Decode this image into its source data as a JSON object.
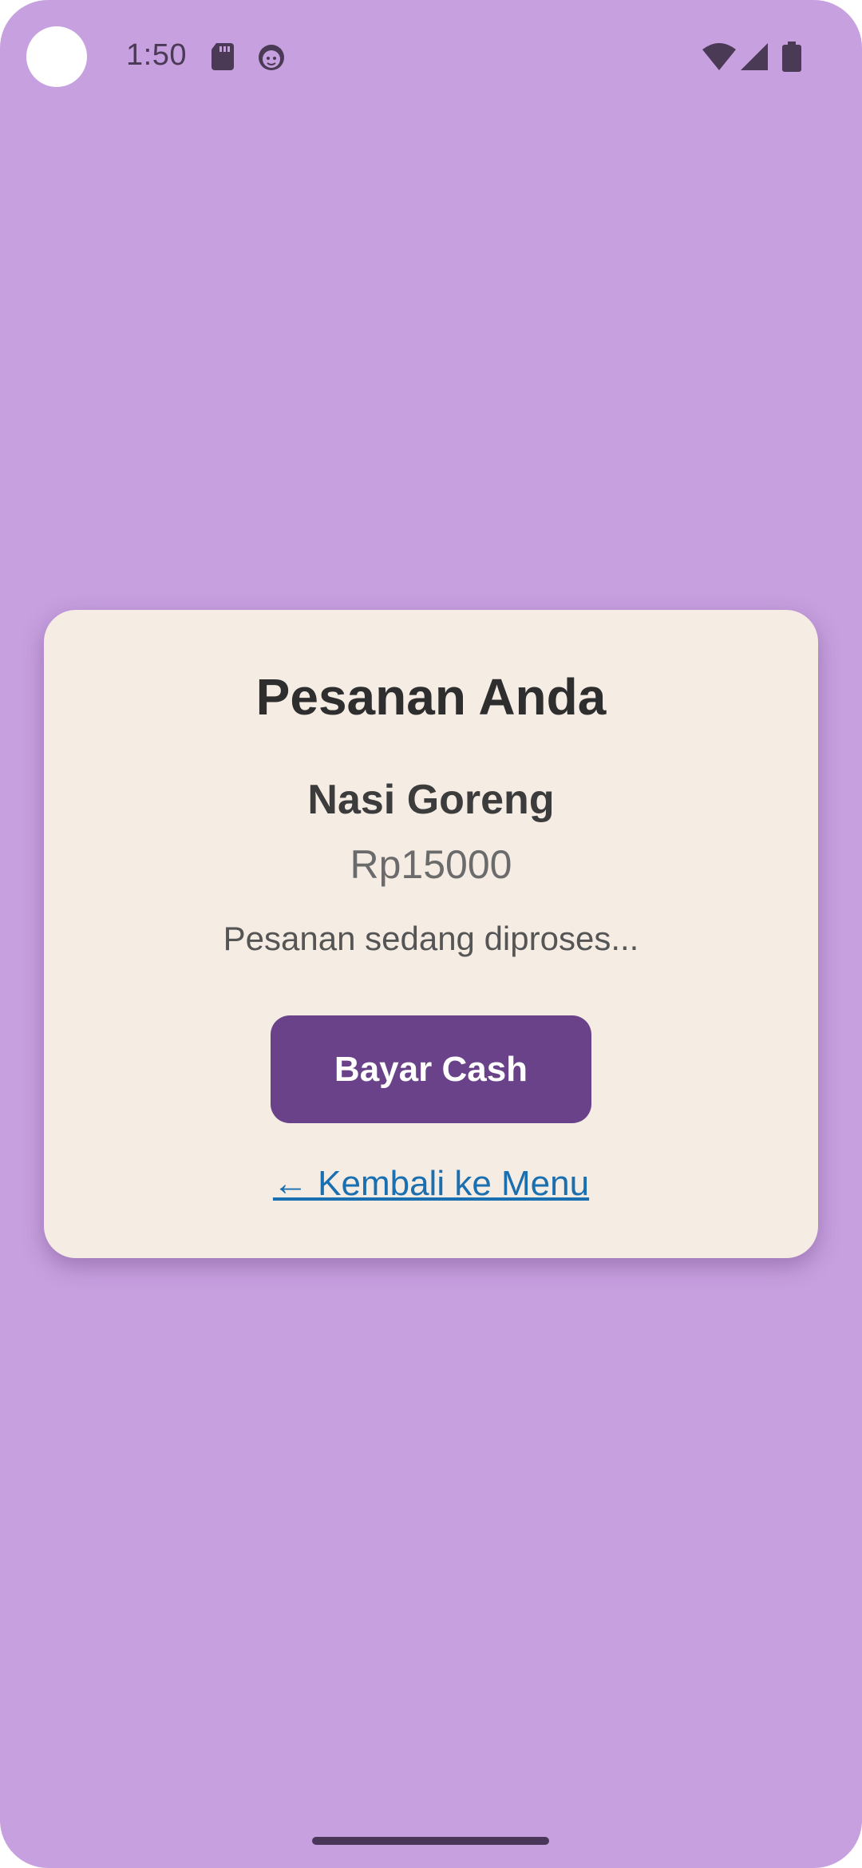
{
  "status_bar": {
    "time": "1:50",
    "icons": [
      "sd-card-icon",
      "face-icon",
      "wifi-icon",
      "signal-icon",
      "battery-icon"
    ],
    "icon_color": "#4a3a55"
  },
  "order_card": {
    "title": "Pesanan Anda",
    "item_name": "Nasi Goreng",
    "item_price": "Rp15000",
    "status": "Pesanan sedang diproses...",
    "pay_button_label": "Bayar Cash",
    "back_link_label": "← Kembali ke Menu"
  },
  "colors": {
    "background": "#c7a0e0",
    "card": "#f5ece4",
    "button": "#6a4289",
    "link": "#1a6fb0"
  }
}
